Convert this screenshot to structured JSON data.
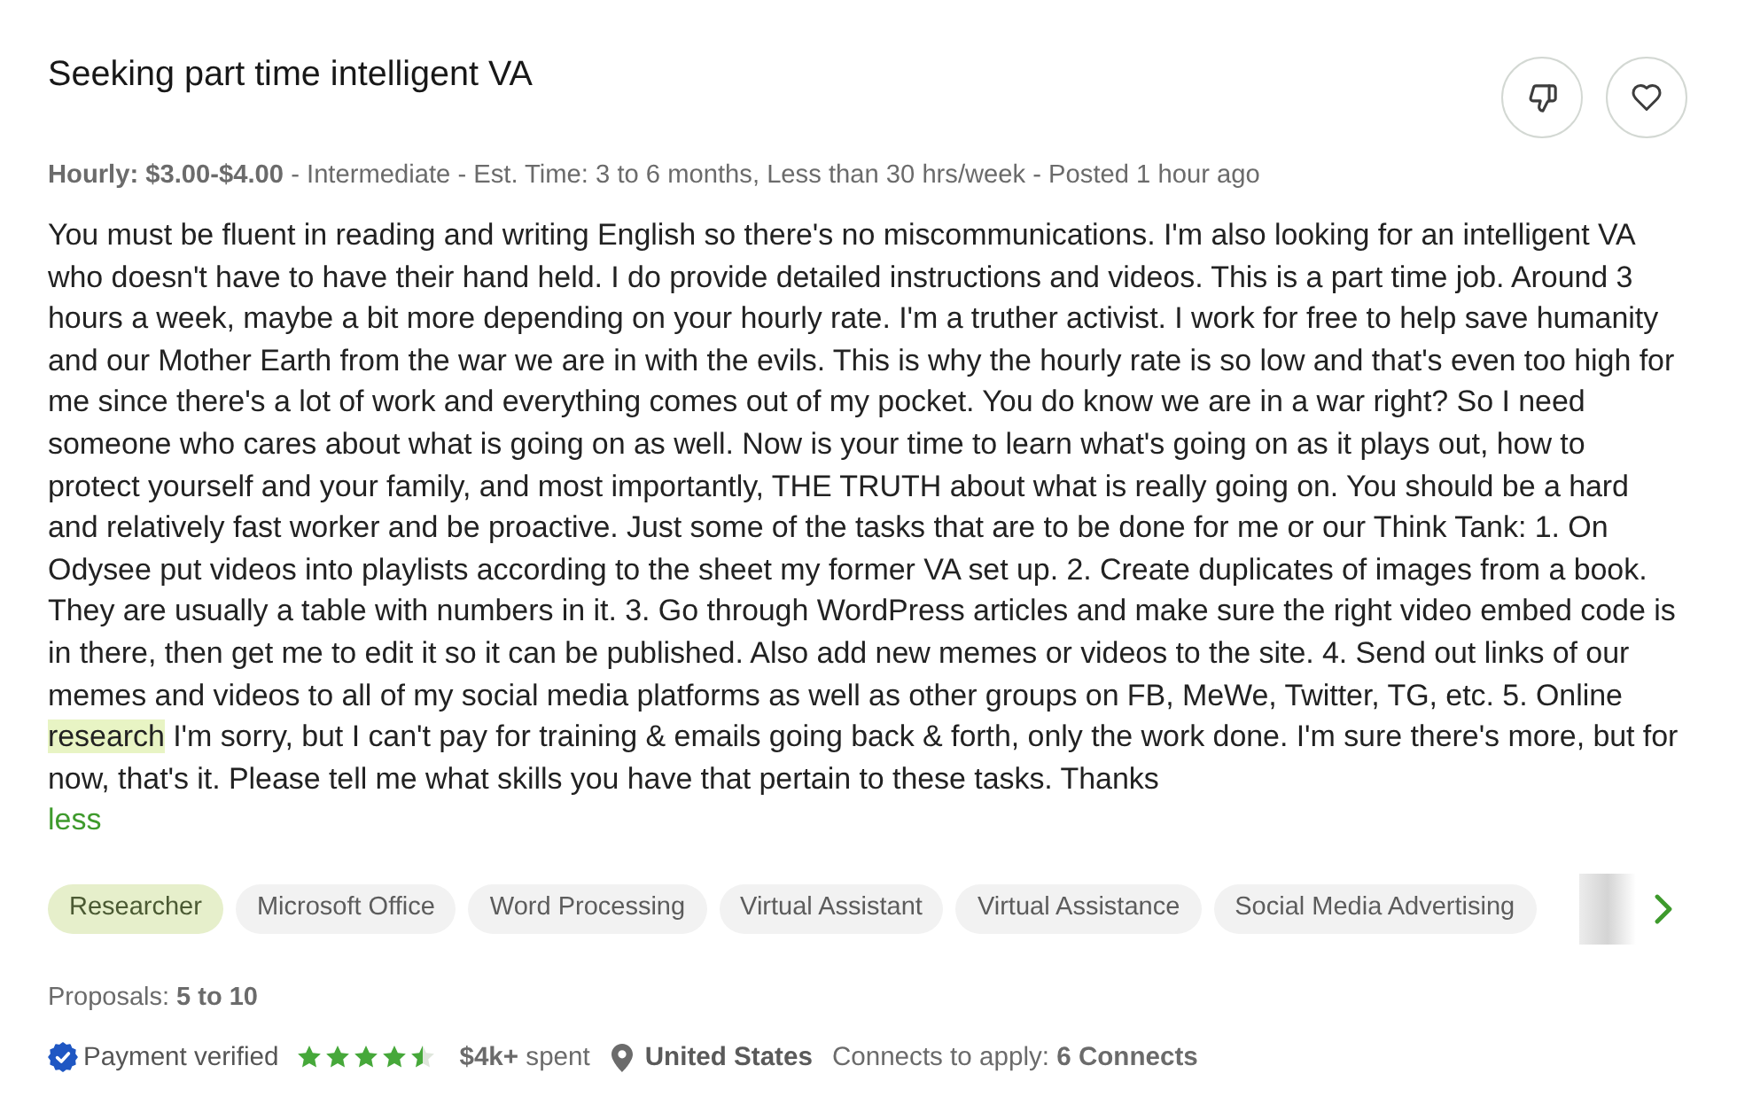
{
  "job": {
    "title": "Seeking part time intelligent VA",
    "meta": "**Hourly: $3.00-$4.00** - Intermediate - Est. Time: 3 to 6 months, Less than 30 hrs/week - Posted 1 hour ago"
  },
  "description": [
    {
      "text": "You must be fluent in reading and writing English so there's no miscommunications. I'm also looking for an intelligent VA who doesn't have to have their hand held. I do provide detailed instructions and videos. This is a part time job. Around 3 hours a week, maybe a bit more depending on your hourly rate. I'm a truther activist. I work for free to help save humanity and our Mother Earth from the war we are in with the evils. This is why the hourly rate is so low and that's even too high for me since there's a lot of work and everything comes out of my pocket. You do know we are in a war right? So I need someone who cares about what is going on as well. Now is your time to learn what's going on as it plays out, how to protect yourself and your family, and most importantly, THE TRUTH about what is really going on. You should be a hard and relatively fast worker and be proactive. Just some of the tasks that are to be done for me or our Think Tank: 1. On Odysee put videos into playlists according to the sheet my former VA set up. 2. Create duplicates of images from a book. They are usually a table with numbers in it. 3. Go through WordPress articles and make sure the right video embed code is in there, then get me to edit it so it can be published. Also add new memes or videos to the site. 4. Send out links of our memes and videos to all of my social media platforms as well as other groups on FB, MeWe, Twitter, TG, etc. 5. Online ",
      "highlighted": false
    },
    {
      "text": "research",
      "highlighted": true
    },
    {
      "text": " I'm sorry, but I can't pay for training & emails going back & forth, only the work done. I'm sure there's more, but for now, that's it. Please tell me what skills you have that pertain to these tasks. Thanks",
      "highlighted": false
    }
  ],
  "toggle_link": "less",
  "skills": [
    {
      "label": "Researcher",
      "highlighted": true
    },
    {
      "label": "Microsoft Office",
      "highlighted": false
    },
    {
      "label": "Word Processing",
      "highlighted": false
    },
    {
      "label": "Virtual Assistant",
      "highlighted": false
    },
    {
      "label": "Virtual Assistance",
      "highlighted": false
    },
    {
      "label": "Social Media Advertising",
      "highlighted": false
    }
  ],
  "proposals": "Proposals: **5 to 10**",
  "client": {
    "verified": true,
    "payment_status": "Payment verified",
    "stars": 4.5,
    "spent": "**$4k+** spent",
    "location": "United States",
    "connects": "Connects to apply: **6 Connects**"
  }
}
